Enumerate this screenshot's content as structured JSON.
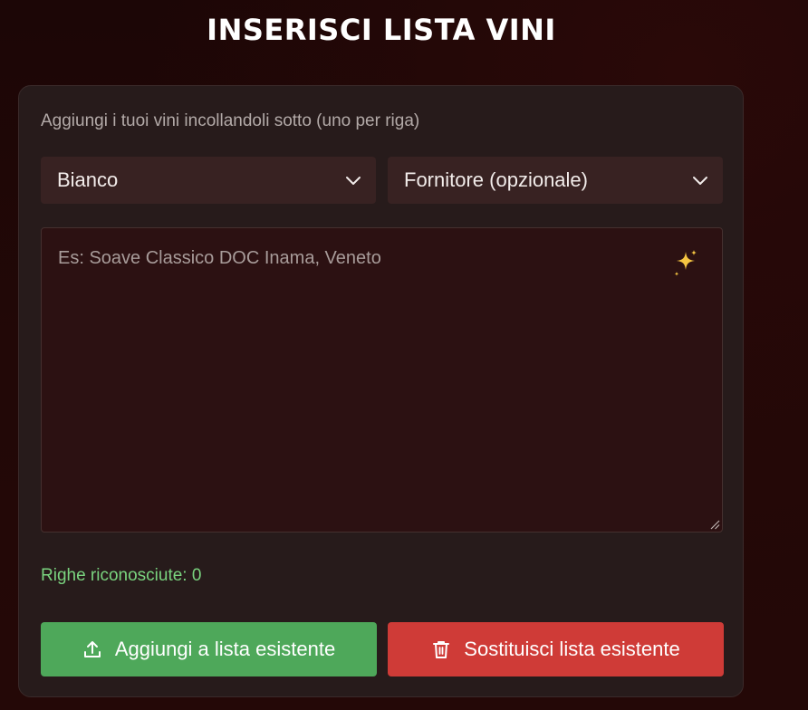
{
  "page": {
    "title": "INSERISCI LISTA VINI"
  },
  "form": {
    "hint": "Aggiungi i tuoi vini incollandoli sotto (uno per riga)",
    "wine_type_select": {
      "selected": "Bianco"
    },
    "supplier_select": {
      "selected": "Fornitore (opzionale)"
    },
    "wine_list_textarea": {
      "value": "",
      "placeholder": "Es: Soave Classico DOC Inama, Veneto"
    },
    "recognized_lines_text": "Righe riconosciute: 0",
    "add_button_label": "Aggiungi a lista esistente",
    "replace_button_label": "Sostituisci lista esistente"
  },
  "icons": {
    "select_chevron": "chevron-down-icon",
    "sparkle": "sparkle-icon",
    "upload": "upload-icon",
    "trash": "trash-icon",
    "resize": "resize-handle-icon"
  },
  "colors": {
    "card_bg": "#271b1b",
    "select_bg": "#382222",
    "textarea_bg": "#2c1112",
    "recognized_text": "#7ad47f",
    "add_button_bg": "#4ea85a",
    "replace_button_bg": "#cf3b37",
    "sparkle": "#f5c542"
  }
}
